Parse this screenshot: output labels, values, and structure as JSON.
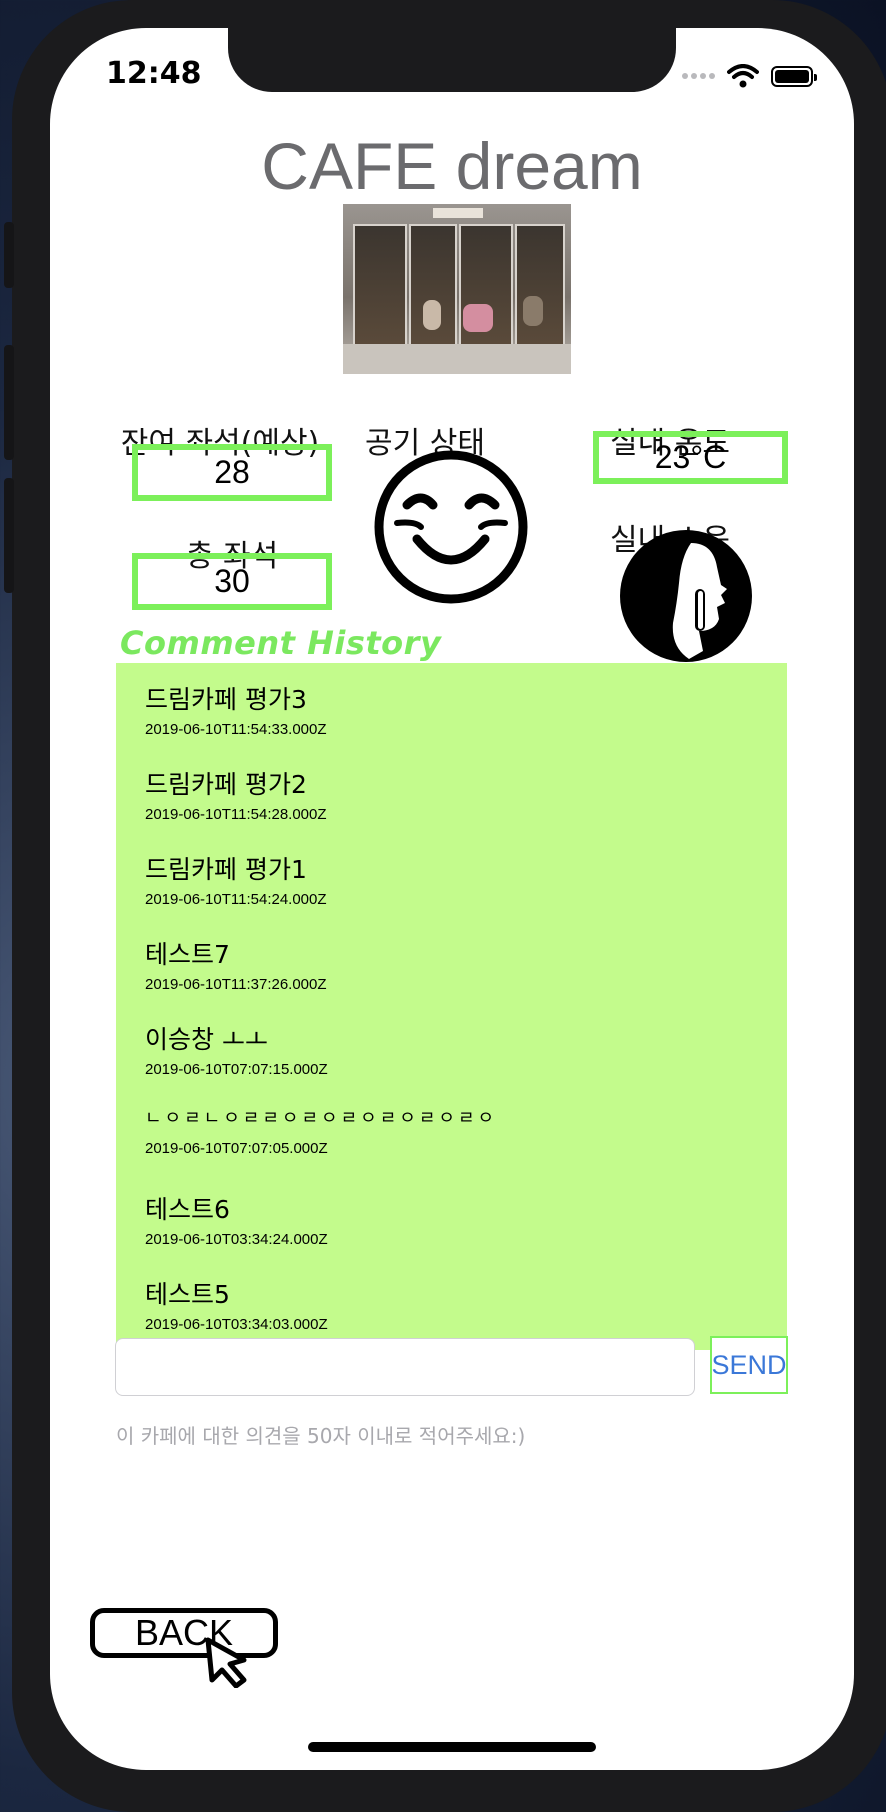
{
  "status_bar": {
    "time": "12:48"
  },
  "app": {
    "title": "CAFE dream"
  },
  "stats": {
    "remaining_seats_label": "잔여 좌석(예상)",
    "remaining_seats_value": "28",
    "total_seats_label": "총 좌석",
    "total_seats_value": "30",
    "air_quality_label": "공기 상태",
    "air_quality_icon": "smiling-face-icon",
    "temperature_label": "실내 온도",
    "temperature_value": "23°C",
    "noise_label": "실내 소음",
    "noise_icon": "quiet-shush-icon"
  },
  "comments": {
    "title": "Comment History",
    "items": [
      {
        "text": "드림카페 평가3",
        "date": "2019-06-10T11:54:33.000Z"
      },
      {
        "text": "드림카페 평가2",
        "date": "2019-06-10T11:54:28.000Z"
      },
      {
        "text": "드림카페 평가1",
        "date": "2019-06-10T11:54:24.000Z"
      },
      {
        "text": "테스트7",
        "date": "2019-06-10T11:37:26.000Z"
      },
      {
        "text": "이승창 ㅗㅗ",
        "date": "2019-06-10T07:07:15.000Z"
      },
      {
        "text": "ㄴㅇㄹㄴㅇㄹㄹㅇㄹㅇㄹㅇㄹㅇㄹㅇㄹㅇ",
        "date": "2019-06-10T07:07:05.000Z"
      },
      {
        "text": "테스트6",
        "date": "2019-06-10T03:34:24.000Z"
      },
      {
        "text": "테스트5",
        "date": "2019-06-10T03:34:03.000Z"
      }
    ]
  },
  "comment_form": {
    "value": "",
    "send_label": "SEND",
    "hint": "이 카페에 대한 의견을 50자 이내로 적어주세요:)"
  },
  "back_button": {
    "label": "BACK"
  },
  "colors": {
    "accent_green": "#7cf05a",
    "list_bg": "#c3fb8c",
    "send_blue": "#3b78d8"
  }
}
